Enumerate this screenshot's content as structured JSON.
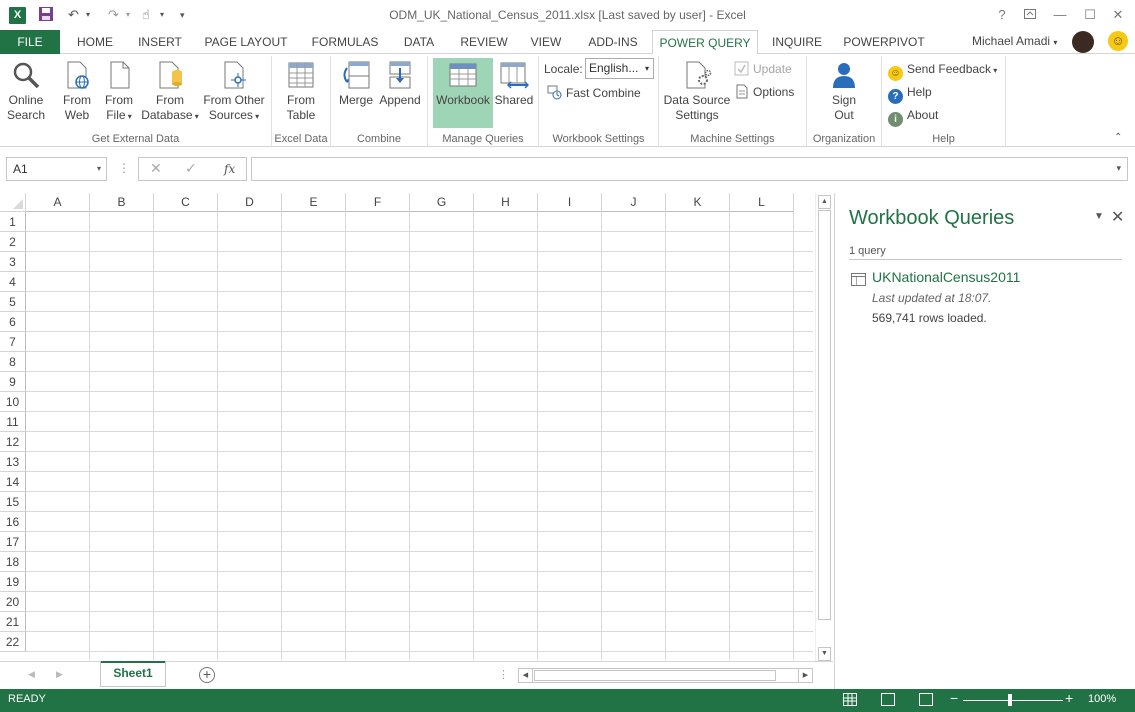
{
  "window": {
    "title": "ODM_UK_National_Census_2011.xlsx [Last saved by user] - Excel",
    "help_glyph": "?"
  },
  "tabs": {
    "file": "FILE",
    "items": [
      "HOME",
      "INSERT",
      "PAGE LAYOUT",
      "FORMULAS",
      "DATA",
      "REVIEW",
      "VIEW",
      "ADD-INS",
      "POWER QUERY",
      "INQUIRE",
      "POWERPIVOT"
    ],
    "active": "POWER QUERY",
    "user": "Michael Amadi"
  },
  "ribbon": {
    "get_external_data": {
      "label": "Get External Data",
      "online_search": [
        "Online",
        "Search"
      ],
      "from_web": [
        "From",
        "Web"
      ],
      "from_file": [
        "From",
        "File"
      ],
      "from_database": [
        "From",
        "Database"
      ],
      "from_other": [
        "From Other",
        "Sources"
      ]
    },
    "excel_data": {
      "label": "Excel Data",
      "from_table": [
        "From",
        "Table"
      ]
    },
    "combine": {
      "label": "Combine",
      "merge": "Merge",
      "append": "Append"
    },
    "manage_queries": {
      "label": "Manage Queries",
      "workbook": "Workbook",
      "shared": "Shared"
    },
    "workbook_settings": {
      "label": "Workbook Settings",
      "locale_label": "Locale:",
      "locale_value": "English...",
      "fast_combine": "Fast Combine"
    },
    "machine_settings": {
      "label": "Machine Settings",
      "data_source": [
        "Data Source",
        "Settings"
      ],
      "update": "Update",
      "options": "Options"
    },
    "organization": {
      "label": "Organization",
      "sign_out": [
        "Sign",
        "Out"
      ]
    },
    "help": {
      "label": "Help",
      "send_feedback": "Send Feedback",
      "help": "Help",
      "about": "About"
    }
  },
  "formula_bar": {
    "name_box": "A1",
    "fx": "fx",
    "formula": ""
  },
  "grid": {
    "columns": [
      "A",
      "B",
      "C",
      "D",
      "E",
      "F",
      "G",
      "H",
      "I",
      "J",
      "K",
      "L"
    ],
    "rows": [
      "1",
      "2",
      "3",
      "4",
      "5",
      "6",
      "7",
      "8",
      "9",
      "10",
      "11",
      "12",
      "13",
      "14",
      "15",
      "16",
      "17",
      "18",
      "19",
      "20",
      "21",
      "22"
    ]
  },
  "sheets": {
    "items": [
      "Sheet1"
    ],
    "active": "Sheet1"
  },
  "pane": {
    "title": "Workbook Queries",
    "count": "1 query",
    "query": {
      "name": "UKNationalCensus2011",
      "updated": "Last updated at 18:07.",
      "rows": "569,741 rows loaded."
    }
  },
  "status": {
    "text": "READY",
    "zoom": "100%",
    "zoom_percent": 100
  },
  "colors": {
    "accent": "#217346",
    "active_button": "#9fd5b7"
  }
}
